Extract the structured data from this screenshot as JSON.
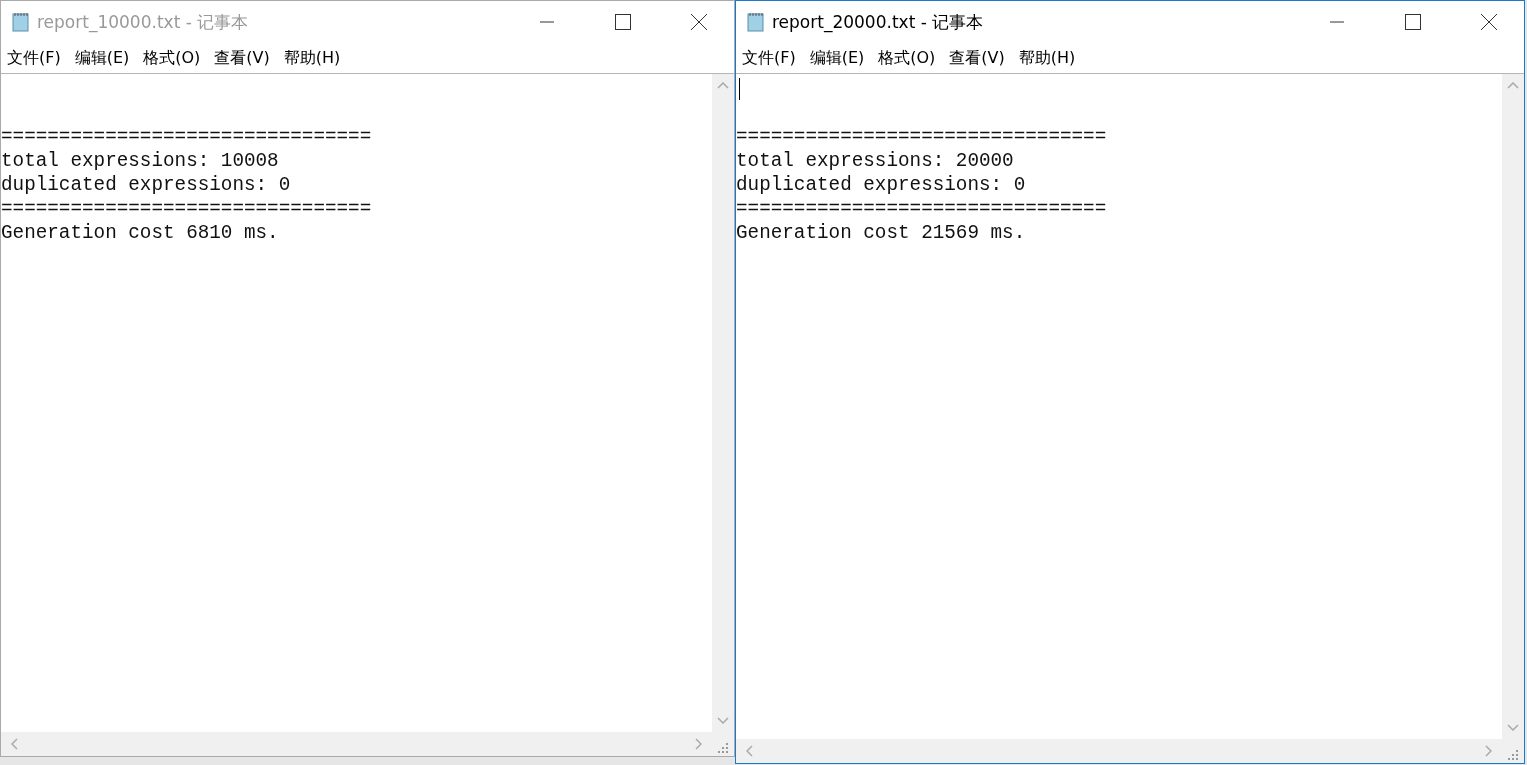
{
  "windows": [
    {
      "title": "report_10000.txt - 记事本",
      "active": false,
      "menu": [
        "文件(F)",
        "编辑(E)",
        "格式(O)",
        "查看(V)",
        "帮助(H)"
      ],
      "lines": [
        "================================",
        "total expressions: 10008",
        "duplicated expressions: 0",
        "================================",
        "Generation cost 6810 ms."
      ]
    },
    {
      "title": "report_20000.txt - 记事本",
      "active": true,
      "menu": [
        "文件(F)",
        "编辑(E)",
        "格式(O)",
        "查看(V)",
        "帮助(H)"
      ],
      "lines": [
        "================================",
        "total expressions: 20000",
        "duplicated expressions: 0",
        "================================",
        "Generation cost 21569 ms."
      ]
    }
  ]
}
